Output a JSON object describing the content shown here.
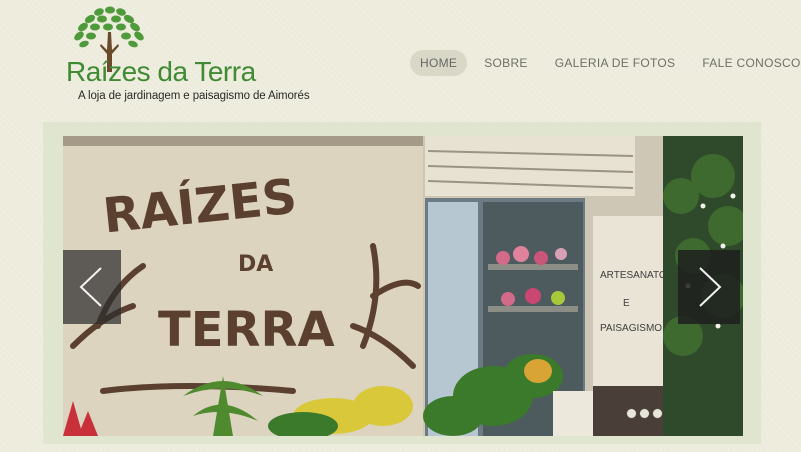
{
  "logo": {
    "name": "Raízes da Terra",
    "tagline": "A loja de jardinagem e paisagismo de Aimorés"
  },
  "nav": {
    "items": [
      {
        "label": "HOME",
        "active": true
      },
      {
        "label": "SOBRE",
        "active": false
      },
      {
        "label": "GALERIA DE FOTOS",
        "active": false
      },
      {
        "label": "FALE CONOSCO",
        "active": false
      }
    ]
  },
  "slider": {
    "wall_sign": {
      "line1": "RAÍZES",
      "line2": "DA",
      "line3": "TERRA"
    },
    "shop_sign": {
      "line1": "ARTESANATO",
      "line2": "E",
      "line3": "PAISAGISMO"
    },
    "dots": 3,
    "active_dot": 0
  },
  "colors": {
    "background": "#ecebdc",
    "brand_green": "#3f8a32",
    "nav_active_bg": "#d9d8c7",
    "nav_text": "#6f6f66",
    "wall_text": "#5b4030"
  },
  "icons": {
    "prev": "chevron-left-icon",
    "next": "chevron-right-icon",
    "logo": "tree-icon"
  }
}
